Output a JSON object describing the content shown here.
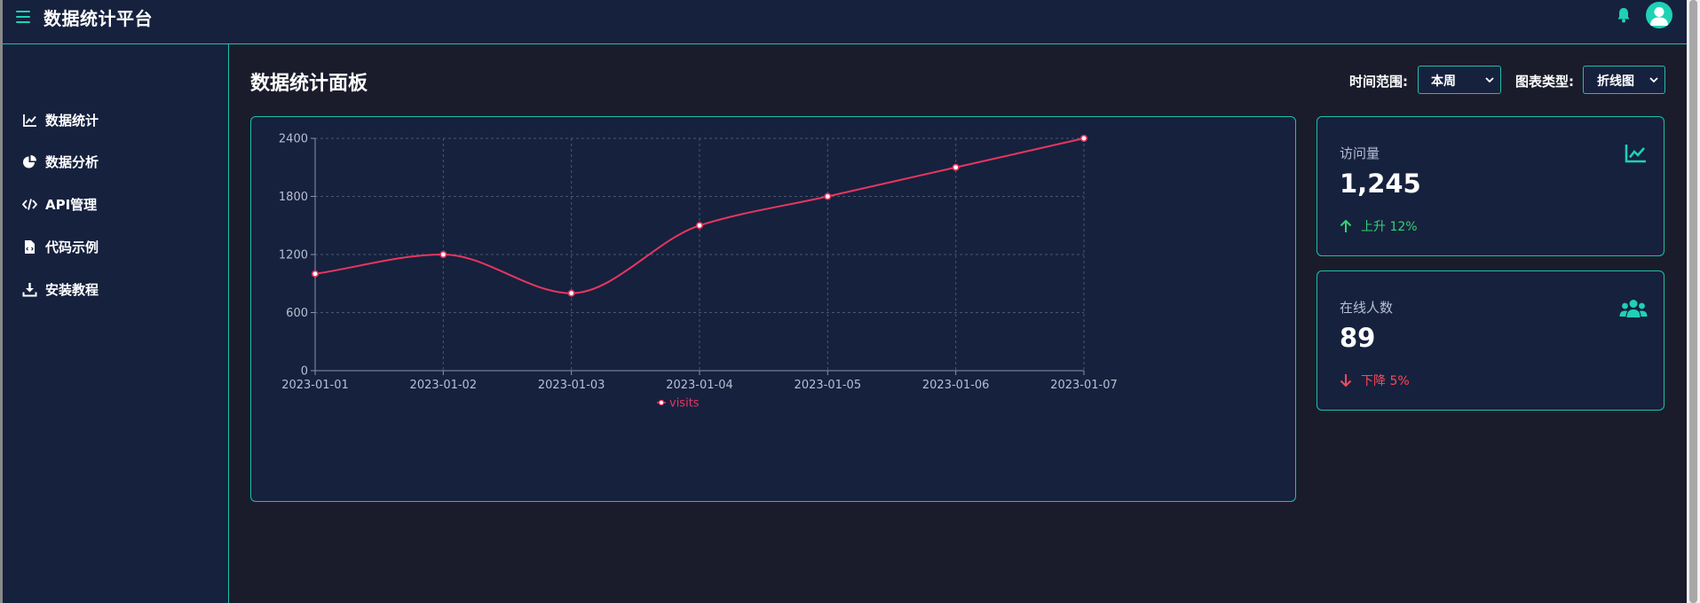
{
  "header": {
    "app_title": "数据统计平台"
  },
  "sidebar": {
    "items": [
      {
        "label": "数据统计",
        "icon": "line-chart-icon"
      },
      {
        "label": "数据分析",
        "icon": "pie-chart-icon"
      },
      {
        "label": "API管理",
        "icon": "code-icon"
      },
      {
        "label": "代码示例",
        "icon": "file-code-icon"
      },
      {
        "label": "安装教程",
        "icon": "download-icon"
      }
    ]
  },
  "main": {
    "page_title": "数据统计面板",
    "filters": {
      "time_range_label": "时间范围:",
      "time_range_value": "本周",
      "chart_type_label": "图表类型:",
      "chart_type_value": "折线图"
    }
  },
  "stats": [
    {
      "title": "访问量",
      "value": "1,245",
      "change": "上升 12%",
      "direction": "up",
      "icon": "line-chart-icon"
    },
    {
      "title": "在线人数",
      "value": "89",
      "change": "下降 5%",
      "direction": "down",
      "icon": "users-icon"
    }
  ],
  "colors": {
    "accent": "#1fd1b5",
    "panel_bg": "#16213e",
    "page_bg": "#1b1c2b",
    "line": "#e8365e",
    "up": "#2ed573",
    "down": "#ff4757"
  },
  "chart_data": {
    "type": "line",
    "x": [
      "2023-01-01",
      "2023-01-02",
      "2023-01-03",
      "2023-01-04",
      "2023-01-05",
      "2023-01-06",
      "2023-01-07"
    ],
    "series": [
      {
        "name": "visits",
        "values": [
          1000,
          1200,
          800,
          1500,
          1800,
          2100,
          2400
        ]
      }
    ],
    "ylim": [
      0,
      2400
    ],
    "yticks": [
      0,
      600,
      1200,
      1800,
      2400
    ],
    "smooth": true,
    "grid": true,
    "legend": "bottom-center"
  }
}
